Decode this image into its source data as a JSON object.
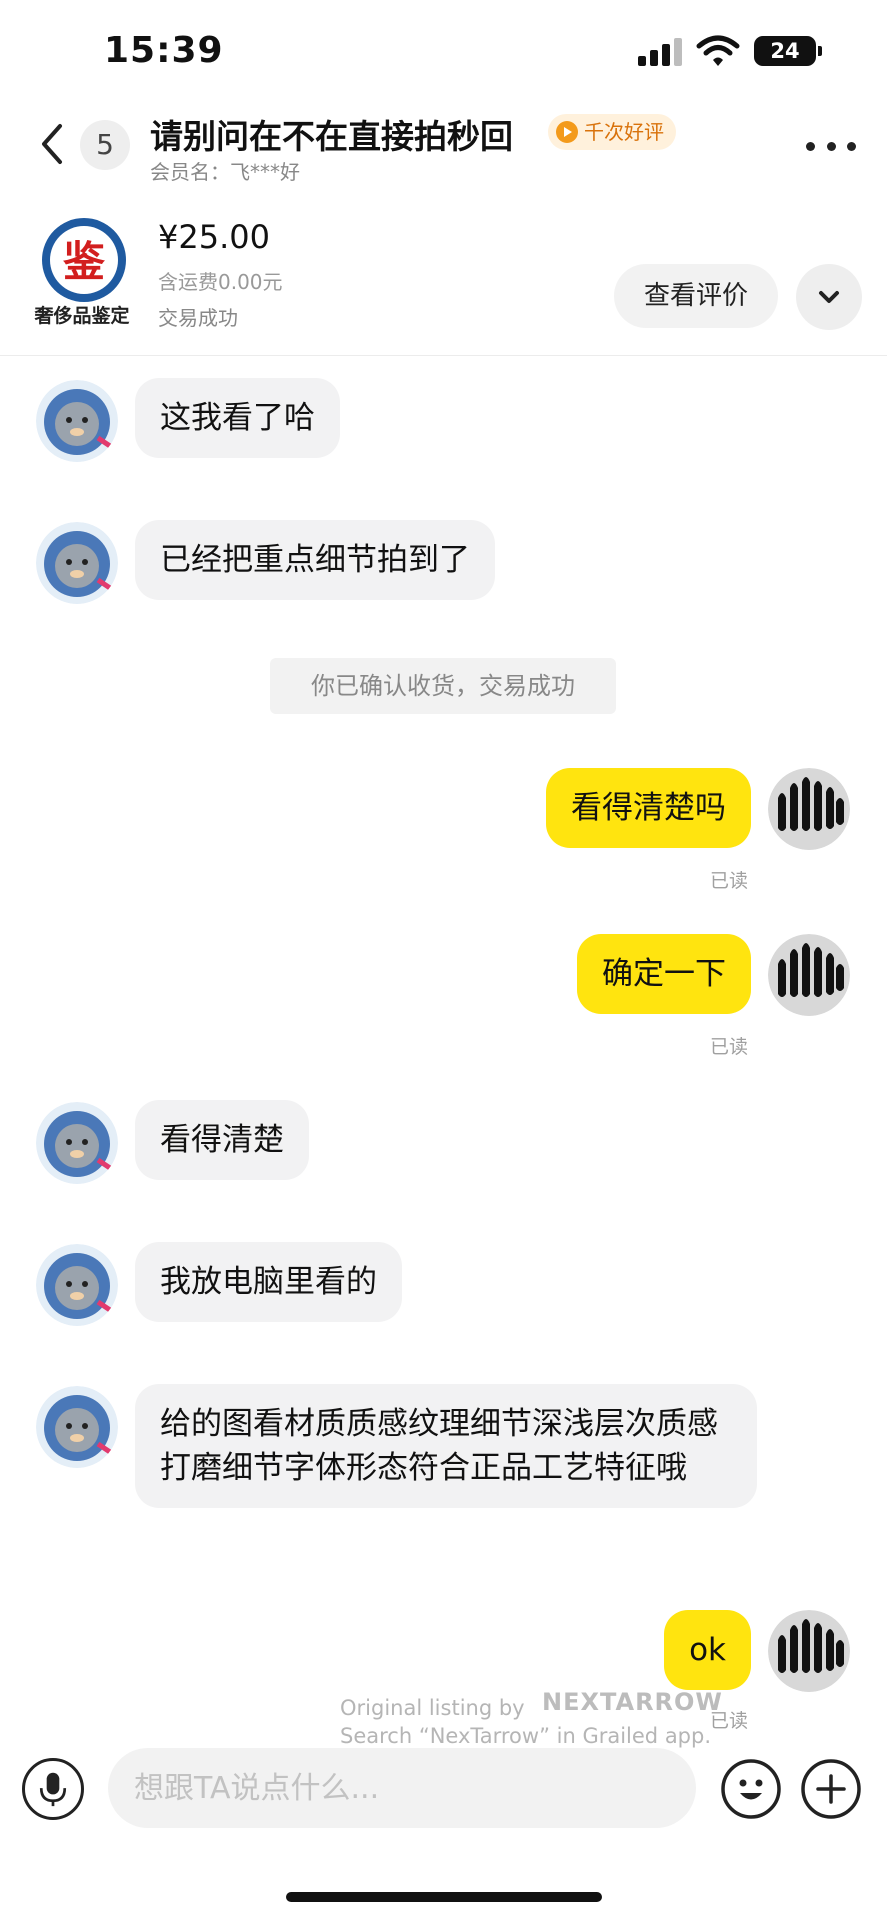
{
  "status_bar": {
    "time": "15:39",
    "battery": "24"
  },
  "header": {
    "unread_count": "5",
    "title": "请别问在不在直接拍秒回",
    "badge": "千次好评",
    "member": "会员名：飞***好"
  },
  "product": {
    "logo_text": "鉴",
    "logo_caption": "奢侈品鉴定",
    "price": "¥25.00",
    "shipping": "含运费0.00元",
    "status": "交易成功",
    "review_button": "查看评价"
  },
  "messages": [
    {
      "direction": "in",
      "text": "这我看了哈"
    },
    {
      "direction": "in",
      "text": "已经把重点细节拍到了"
    },
    {
      "direction": "system",
      "text": "你已确认收货，交易成功"
    },
    {
      "direction": "out",
      "text": "看得清楚吗",
      "read": "已读"
    },
    {
      "direction": "out",
      "text": "确定一下",
      "read": "已读"
    },
    {
      "direction": "in",
      "text": "看得清楚"
    },
    {
      "direction": "in",
      "text": "我放电脑里看的"
    },
    {
      "direction": "in",
      "text": "给的图看材质质感纹理细节深浅层次质感打磨细节字体形态符合正品工艺特征哦"
    },
    {
      "direction": "out",
      "text": "ok",
      "read": "已读"
    }
  ],
  "watermark": {
    "line1": "Original listing by",
    "brand": "NEXTARROW",
    "line2": "Search “NexTarrow” in Grailed app."
  },
  "input": {
    "placeholder": "想跟TA说点什么..."
  },
  "icons": {
    "back": "chevron-left-icon",
    "more": "more-dots-icon",
    "expand": "chevron-down-icon",
    "mic": "microphone-icon",
    "emoji": "smiley-icon",
    "plus": "plus-icon"
  },
  "colors": {
    "outgoing_bubble": "#ffe40f",
    "incoming_bubble": "#f2f2f3",
    "badge_text": "#d9720b"
  }
}
